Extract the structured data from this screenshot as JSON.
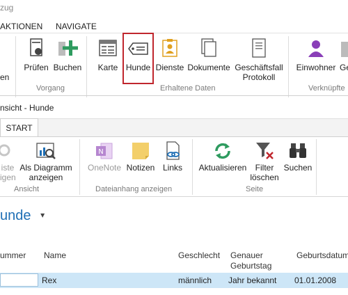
{
  "top_window": {
    "title_fragment": "zug",
    "menu": [
      "AKTIONEN",
      "NAVIGATE"
    ],
    "ribbon": {
      "left_cut_label": "en",
      "buttons": {
        "pruefen": "Prüfen",
        "buchen": "Buchen",
        "karte": "Karte",
        "hunde": "Hunde",
        "dienste": "Dienste",
        "dokumente": "Dokumente",
        "geschaeftsfall_line1": "Geschäftsfall",
        "geschaeftsfall_line2": "Protokoll",
        "einwohner": "Einwohner",
        "cut_right": "Ge"
      },
      "groups": {
        "vorgang": "Vorgang",
        "erhaltene_daten": "Erhaltene Daten",
        "verknuepfte": "Verknüpfte"
      }
    }
  },
  "child_window": {
    "title": "nsicht - Hunde",
    "tab": "START",
    "ribbon": {
      "buttons": {
        "disabled_cut_line1": "iste",
        "disabled_cut_line2": "igen",
        "diagramm_line1": "Als Diagramm",
        "diagramm_line2": "anzeigen",
        "onenote": "OneNote",
        "notizen": "Notizen",
        "links": "Links",
        "aktualisieren": "Aktualisieren",
        "filter_line1": "Filter",
        "filter_line2": "löschen",
        "suchen": "Suchen"
      },
      "groups": {
        "ansicht": "Ansicht",
        "dateianhang": "Dateianhang anzeigen",
        "seite": "Seite"
      }
    },
    "list_title": "unde",
    "table": {
      "headers": {
        "nummer": "ummer",
        "name": "Name",
        "geschlecht": "Geschlecht",
        "genauer_line1": "Genauer",
        "genauer_line2": "Geburtstag",
        "geburtsdatum": "Geburtsdatum"
      },
      "rows": [
        {
          "name": "Rex",
          "geschlecht": "männlich",
          "genauer": "Jahr bekannt",
          "geburtsdatum": "01.01.2008"
        }
      ]
    }
  },
  "colors": {
    "accent_blue": "#1f6fb5",
    "highlight_red": "#c0262d",
    "row_selected": "#cde6f7",
    "icon_green": "#2e9b5f",
    "icon_purple": "#8a3fb8"
  }
}
